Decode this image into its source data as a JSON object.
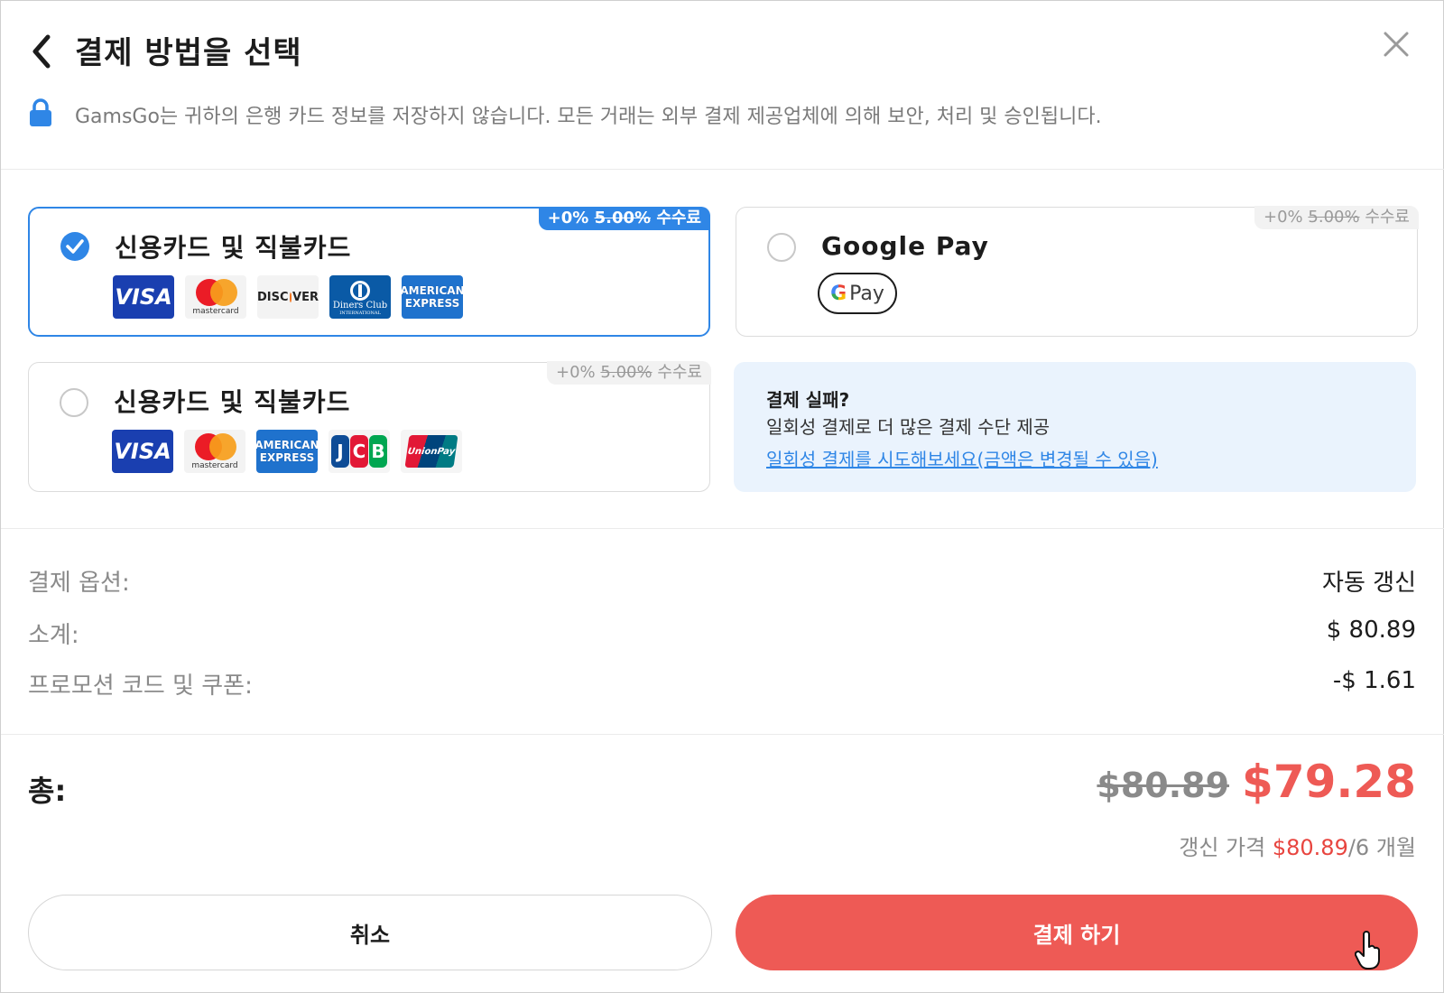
{
  "header": {
    "title": "결제 방법을 선택",
    "secure_note": "GamsGo는 귀하의 은행 카드 정보를 저장하지 않습니다. 모든 거래는 외부 결제 제공업체에 의해 보안, 처리 및 승인됩니다."
  },
  "payment_methods": [
    {
      "label": "신용카드 및 직불카드",
      "selected": true,
      "fee_prefix": "+0%",
      "fee_original": "5.00%",
      "fee_suffix": "수수료",
      "logos": [
        "VISA",
        "mastercard",
        "DISCOVER",
        "Diners Club",
        "AMERICAN EXPRESS"
      ]
    },
    {
      "label": "Google Pay",
      "selected": false,
      "fee_prefix": "+0%",
      "fee_original": "5.00%",
      "fee_suffix": "수수료",
      "button_text": "Pay"
    },
    {
      "label": "신용카드 및 직불카드",
      "selected": false,
      "fee_prefix": "+0%",
      "fee_original": "5.00%",
      "fee_suffix": "수수료",
      "logos": [
        "VISA",
        "mastercard",
        "AMERICAN EXPRESS",
        "JCB",
        "UnionPay"
      ]
    }
  ],
  "logo_text": {
    "visa": "VISA",
    "mastercard": "mastercard",
    "discover_left": "DISC",
    "discover_right": "VER",
    "diners_name": "Diners Club",
    "diners_sub": "INTERNATIONAL",
    "amex_top": "AMERICAN",
    "amex_bottom": "EXPRESS",
    "jcb": [
      "J",
      "C",
      "B"
    ],
    "unionpay": "UnionPay"
  },
  "payment_failed": {
    "title": "결제 실패?",
    "description": "일회성 결제로 더 많은 결제 수단 제공",
    "link": "일회성 결제를 시도해보세요(금액은 변경될 수 있음)"
  },
  "summary": {
    "rows": [
      {
        "label": "결제 옵션:",
        "value": "자동 갱신"
      },
      {
        "label": "소계:",
        "value": "$ 80.89"
      },
      {
        "label": "프로모션 코드 및 쿠폰:",
        "value": "-$ 1.61"
      }
    ],
    "total_label": "총:",
    "original_price": "$80.89",
    "final_price": "$79.28",
    "renewal_prefix": "갱신 가격",
    "renewal_price": "$80.89",
    "renewal_suffix": "/6 개월"
  },
  "actions": {
    "cancel": "취소",
    "pay": "결제 하기"
  },
  "colors": {
    "accent_blue": "#2f86e6",
    "accent_red": "#ee5a55",
    "info_bg": "#eaf3fd"
  },
  "icons": [
    "back-chevron-icon",
    "close-icon",
    "lock-icon",
    "check-icon",
    "google-g-icon",
    "hand-cursor-icon"
  ]
}
